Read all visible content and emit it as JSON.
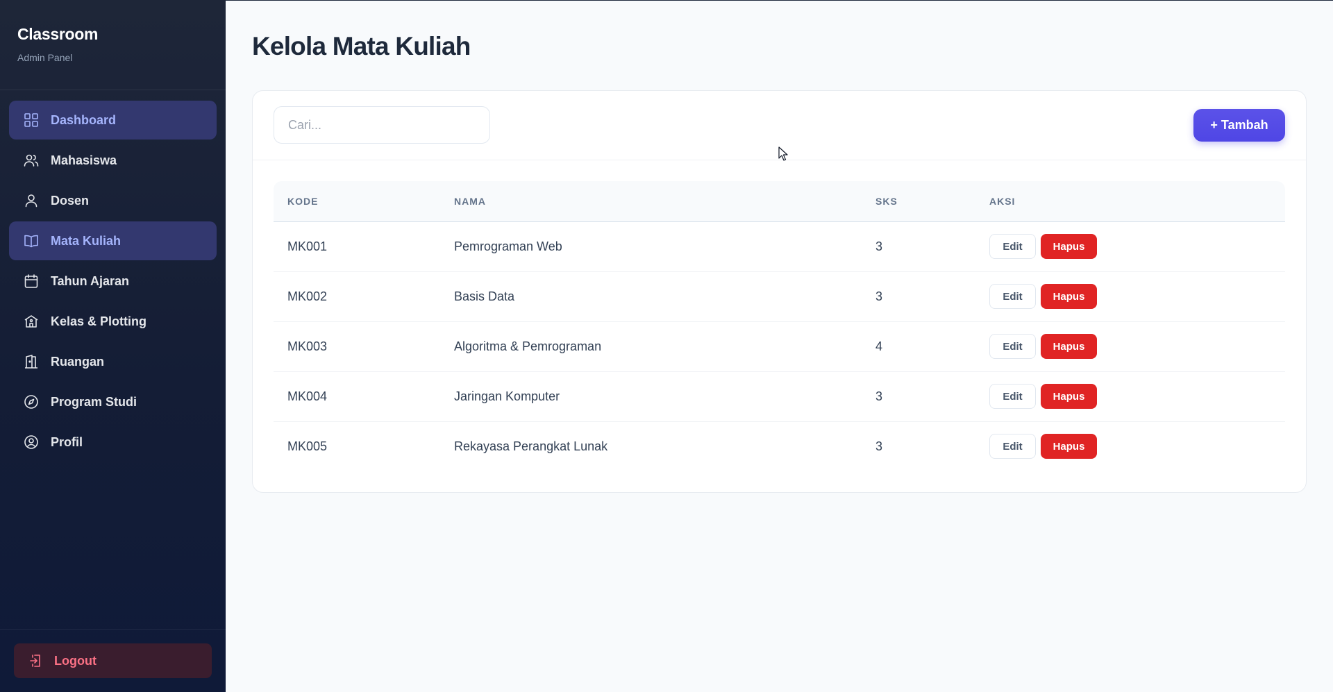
{
  "brand": {
    "title": "Classroom",
    "subtitle": "Admin Panel"
  },
  "sidebar": {
    "items": [
      {
        "label": "Dashboard",
        "icon": "grid-icon",
        "active": true
      },
      {
        "label": "Mahasiswa",
        "icon": "users-icon",
        "active": false
      },
      {
        "label": "Dosen",
        "icon": "user-icon",
        "active": false
      },
      {
        "label": "Mata Kuliah",
        "icon": "book-icon",
        "active": true
      },
      {
        "label": "Tahun Ajaran",
        "icon": "calendar-icon",
        "active": false
      },
      {
        "label": "Kelas & Plotting",
        "icon": "school-icon",
        "active": false
      },
      {
        "label": "Ruangan",
        "icon": "door-icon",
        "active": false
      },
      {
        "label": "Program Studi",
        "icon": "compass-icon",
        "active": false
      },
      {
        "label": "Profil",
        "icon": "profile-circle-icon",
        "active": false
      }
    ],
    "logout_label": "Logout",
    "logout_icon": "logout-icon"
  },
  "page": {
    "title": "Kelola Mata Kuliah"
  },
  "toolbar": {
    "search_placeholder": "Cari...",
    "add_label": "+ Tambah"
  },
  "table": {
    "headers": {
      "kode": "KODE",
      "nama": "NAMA",
      "sks": "SKS",
      "aksi": "AKSI"
    },
    "rows": [
      {
        "kode": "MK001",
        "nama": "Pemrograman Web",
        "sks": "3"
      },
      {
        "kode": "MK002",
        "nama": "Basis Data",
        "sks": "3"
      },
      {
        "kode": "MK003",
        "nama": "Algoritma & Pemrograman",
        "sks": "4"
      },
      {
        "kode": "MK004",
        "nama": "Jaringan Komputer",
        "sks": "3"
      },
      {
        "kode": "MK005",
        "nama": "Rekayasa Perangkat Lunak",
        "sks": "3"
      }
    ],
    "edit_label": "Edit",
    "delete_label": "Hapus"
  },
  "colors": {
    "accent": "#4f46e5",
    "danger": "#e02424",
    "sidebar_bg": "#141d36",
    "active_bg": "#33386f"
  }
}
